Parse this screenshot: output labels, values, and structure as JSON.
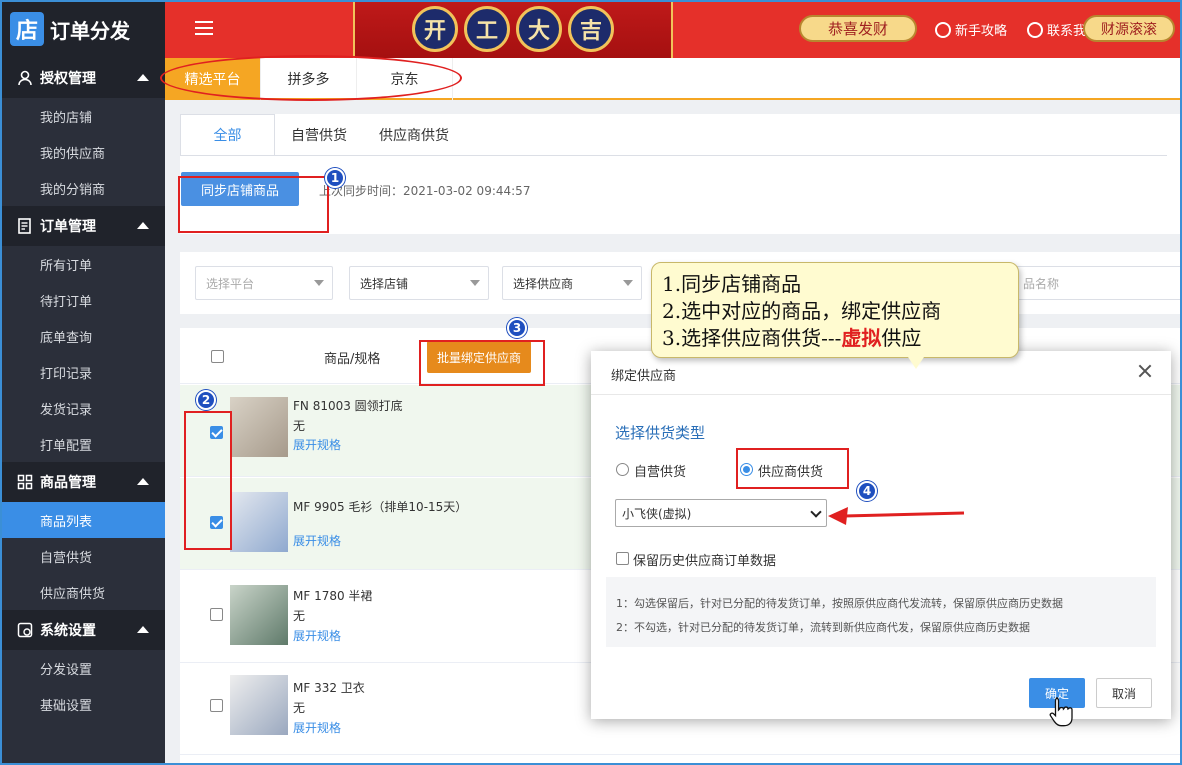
{
  "brand": {
    "logo_char": "店",
    "name": "订单分发"
  },
  "sidebar": {
    "groups": [
      {
        "label": "授权管理",
        "icon": "user-icon",
        "items": [
          "我的店铺",
          "我的供应商",
          "我的分销商"
        ]
      },
      {
        "label": "订单管理",
        "icon": "order-doc-icon",
        "items": [
          "所有订单",
          "待打订单",
          "底单查询",
          "打印记录",
          "发货记录",
          "打单配置"
        ]
      },
      {
        "label": "商品管理",
        "icon": "grid-icon",
        "items": [
          "商品列表",
          "自营供货",
          "供应商供货"
        ],
        "active": "商品列表"
      },
      {
        "label": "系统设置",
        "icon": "settings-icon",
        "items": [
          "分发设置",
          "基础设置"
        ]
      }
    ]
  },
  "header": {
    "menu_icon": "menu-icon",
    "banner": [
      "开",
      "工",
      "大",
      "吉"
    ],
    "greeting": "恭喜发财",
    "links": [
      "新手攻略",
      "联系我们"
    ],
    "right_button": "财源滚滚",
    "theme_color": "#e5302a"
  },
  "platform_tabs": [
    "精选平台",
    "拼多多",
    "京东"
  ],
  "sub_tabs": [
    "全部",
    "自营供货",
    "供应商供货"
  ],
  "sync": {
    "button": "同步店铺商品",
    "last_sync": "上次同步时间：2021-03-02 09:44:57"
  },
  "filters": {
    "platform_placeholder": "选择平台",
    "shop": "选择店铺",
    "supplier": "选择供应商",
    "name_placeholder": "品名称"
  },
  "table": {
    "header_goods": "商品/规格",
    "bulk_button": "批量绑定供应商",
    "rows": [
      {
        "title": "FN 81003 圆领打底",
        "spec": "无",
        "link": "展开规格",
        "checked": true
      },
      {
        "title": "MF 9905 毛衫（排单10-15天）",
        "spec": "无",
        "link": "展开规格",
        "checked": true
      },
      {
        "title": "MF 1780 半裙",
        "spec": "无",
        "link": "展开规格",
        "checked": false
      },
      {
        "title": "MF 332 卫衣",
        "spec": "无",
        "link": "展开规格",
        "checked": false
      }
    ]
  },
  "modal": {
    "title": "绑定供应商",
    "section_title": "选择供货类型",
    "radio_self": "自营供货",
    "radio_supplier": "供应商供货",
    "selected_radio": "供应商供货",
    "supplier_value": "小飞侠(虚拟)",
    "keep_history": "保留历史供应商订单数据",
    "note1": "1：勾选保留后，针对已分配的待发货订单，按照原供应商代发流转，保留原供应商历史数据",
    "note2": "2：不勾选，针对已分配的待发货订单，流转到新供应商代发，保留原供应商历史数据",
    "ok": "确定",
    "cancel": "取消"
  },
  "callout": {
    "line1": "1.同步店铺商品",
    "line2": "2.选中对应的商品，绑定供应商",
    "line3_prefix": "3.选择供应商供货---",
    "line3_highlight": "虚拟",
    "line3_suffix": "供应"
  },
  "annotations": {
    "step_numbers": [
      "1",
      "2",
      "3",
      "4"
    ],
    "accent_color": "#e02020"
  }
}
